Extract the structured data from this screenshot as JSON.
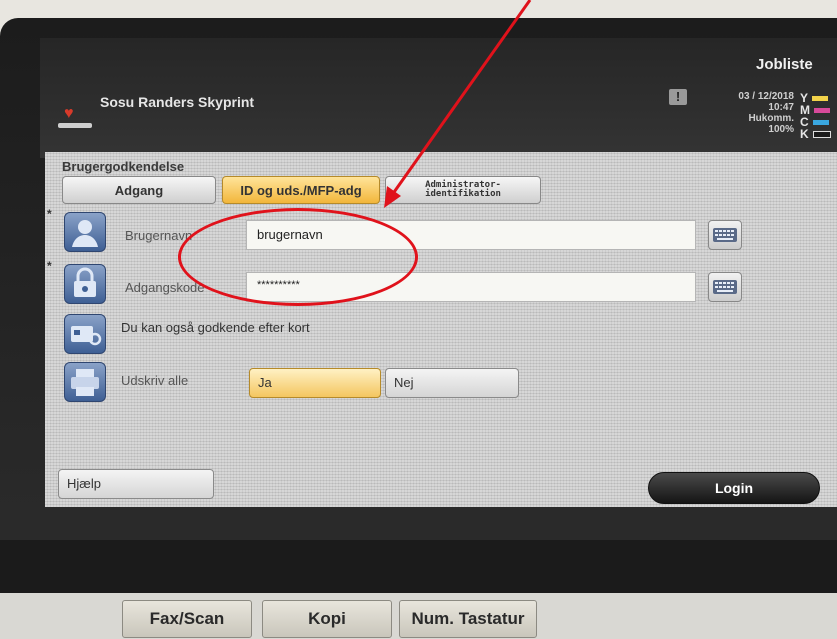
{
  "header": {
    "jobliste": "Jobliste",
    "site_name": "Sosu Randers Skyprint",
    "warning_symbol": "!",
    "status_lines": [
      "03 / 12/2018",
      "10:47",
      "Hukomm.",
      "100%"
    ],
    "toner": [
      {
        "label": "Y",
        "color": "#f2d34a"
      },
      {
        "label": "M",
        "color": "#d84a9a"
      },
      {
        "label": "C",
        "color": "#3aa7e0"
      },
      {
        "label": "K",
        "color": "#1a1a1a"
      }
    ]
  },
  "auth": {
    "section_title": "Brugergodkendelse",
    "tabs": [
      {
        "label": "Adgang",
        "active": false
      },
      {
        "label": "ID og uds./MFP-adg",
        "active": true
      },
      {
        "label_line1": "Administrator-",
        "label_line2": "identifikation",
        "active": false
      }
    ],
    "username": {
      "required": "*",
      "label": "Brugernavn",
      "value": "brugernavn"
    },
    "password": {
      "required": "*",
      "label": "Adgangskode",
      "value": "**********"
    },
    "card_hint": "Du kan også godkende efter kort",
    "print_all": {
      "label": "Udskriv alle",
      "yes": "Ja",
      "no": "Nej",
      "selected": "Ja"
    }
  },
  "footer": {
    "help": "Hjælp",
    "login": "Login"
  },
  "hardware_buttons": [
    "Fax/Scan",
    "Kopi",
    "Num. Tastatur"
  ],
  "annotation_color": "#e0121b"
}
